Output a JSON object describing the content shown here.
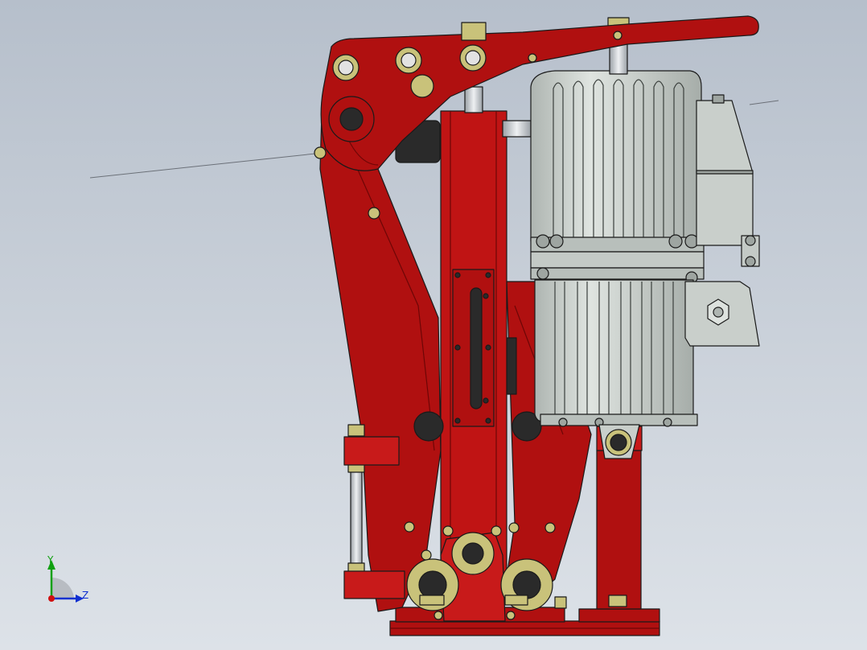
{
  "view": {
    "background_top": "#b6bfcb",
    "background_bottom": "#dde2e8"
  },
  "colors": {
    "frame_red": "#b01010",
    "frame_red_dark": "#6e0606",
    "frame_red_light": "#d02020",
    "motor_gray": "#c9cfcb",
    "motor_gray_dark": "#8e9591",
    "motor_edge": "#3a3f3c",
    "brass": "#c9c27a",
    "brass_dark": "#7b7533",
    "pin_dark": "#2a2a2a",
    "rod_silver": "#d4d8dc",
    "outline": "#1a1a1a",
    "axis_x": "#d01010",
    "axis_y": "#10a010",
    "axis_z": "#1030d0"
  },
  "triad": {
    "y_label": "Y",
    "z_label": "Z"
  }
}
